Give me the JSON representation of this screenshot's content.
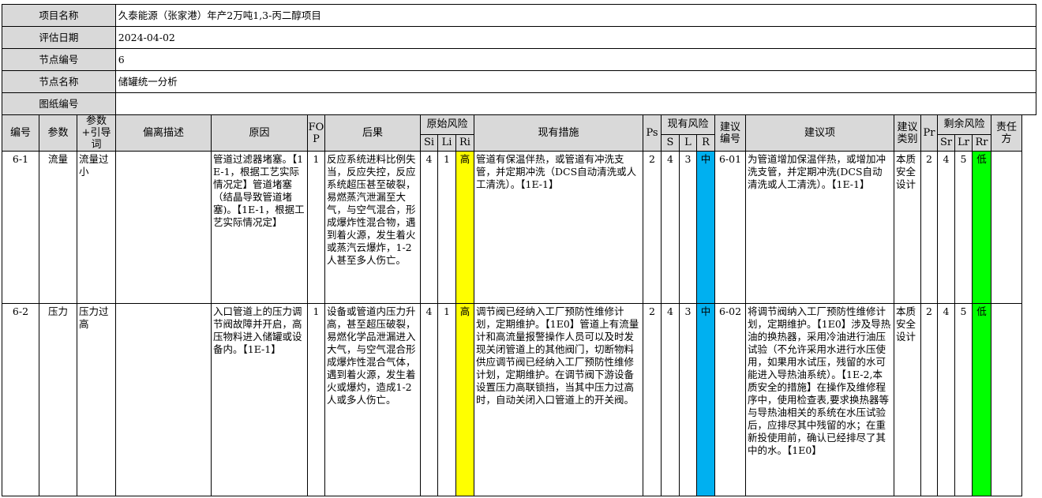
{
  "info": [
    {
      "label": "项目名称",
      "value": "久泰能源（张家港）年产2万吨1,3-丙二醇项目"
    },
    {
      "label": "评估日期",
      "value": "2024-04-02"
    },
    {
      "label": "节点编号",
      "value": "6"
    },
    {
      "label": "节点名称",
      "value": "储罐统一分析"
    },
    {
      "label": "图纸编号",
      "value": ""
    }
  ],
  "headers": {
    "no": "编号",
    "param": "参数",
    "guide": "参数+引导词",
    "deviation": "偏离描述",
    "cause": "原因",
    "fop": "FOP",
    "consequence": "后果",
    "orig_risk": "原始风险",
    "si": "Si",
    "li": "Li",
    "ri": "Ri",
    "measures": "现有措施",
    "ps": "Ps",
    "cur_risk": "现有风险",
    "s": "S",
    "l": "L",
    "r": "R",
    "rec_no": "建议编号",
    "rec": "建议项",
    "rec_type": "建议类别",
    "pr": "Pr",
    "res_risk": "剩余风险",
    "sr": "Sr",
    "lr": "Lr",
    "rr": "Rr",
    "owner": "责任方"
  },
  "rows": [
    {
      "no": "6-1",
      "param": "流量",
      "guide": "流量过小",
      "deviation": "",
      "cause": "管道过滤器堵塞。【1E-1，根据工艺实际情况定】管道堵塞（结晶导致管道堵塞)。【1E-1，根据工艺实际情况定】",
      "fop": "1",
      "consequence": "反应系统进料比例失当，反应失控，反应系统超压甚至破裂，易燃蒸汽泄漏至大气，与空气混合，形成爆炸性混合物，遇到着火源，发生着火或蒸汽云爆炸，1-2人甚至多人伤亡。",
      "si": "4",
      "li": "1",
      "ri": "高",
      "measures": "管道有保温伴热，或管道有冲洗支管，并定期冲洗（DCS自动清洗或人工清洗）。【1E-1】",
      "ps": "2",
      "s": "4",
      "l": "3",
      "r": "中",
      "rec_no": "6-01",
      "rec": "为管道增加保温伴热，或增加冲洗支管，并定期冲洗(DCS自动清洗或人工清洗）。【1E-1】",
      "rec_type": "本质安全设计",
      "pr": "2",
      "sr": "4",
      "lr": "5",
      "rr": "低",
      "owner": ""
    },
    {
      "no": "6-2",
      "param": "压力",
      "guide": "压力过高",
      "deviation": "",
      "cause": "入口管道上的压力调节阀故障并开启，高压物料进入储罐或设备内。【1E-1】",
      "fop": "1",
      "consequence": "设备或管道内压力升高，甚至超压破裂，易燃化学品泄漏进入大气，与空气混合形成爆炸性混合气体，遇到着火源，发生着火或爆灼，造成1-2人或多人伤亡。",
      "si": "4",
      "li": "1",
      "ri": "高",
      "measures": "调节阀已经纳入工厂预防性维修计划，定期维护。【1E0】管道上有流量计和高流量报警操作人员可以及时发现关闭管道上的其他阀门，切断物料供应调节阀已经纳入工厂预防性维修计划，定期维护。在调节阀下游设备设置压力高联锁挡，当其中压力过高时，自动关闭入口管道上的开关阀。",
      "ps": "2",
      "s": "4",
      "l": "3",
      "r": "中",
      "rec_no": "6-02",
      "rec": "将调节阀纳入工厂预防性维修计划，定期维护。【1E0】涉及导热油的换热器，采用冷油进行油压试验（不允许采用水进行水压使用，如果用水试压，残留的水可能进入导热油系统）。【1E-2,本质安全的措施】在操作及维修程序中，使用检查表,要求换热器等与导热油相关的系统在水压试验后，应排尽其中残留的水；在重新投使用前，确认已经排尽了其中的水。【1E0】",
      "rec_type": "本质安全设计",
      "pr": "2",
      "sr": "4",
      "lr": "5",
      "rr": "低",
      "owner": ""
    }
  ],
  "colors": {
    "high": "#ffff00",
    "medium": "#00b0f0",
    "low": "#00ff00",
    "header_bg": "#d9d9d9"
  }
}
